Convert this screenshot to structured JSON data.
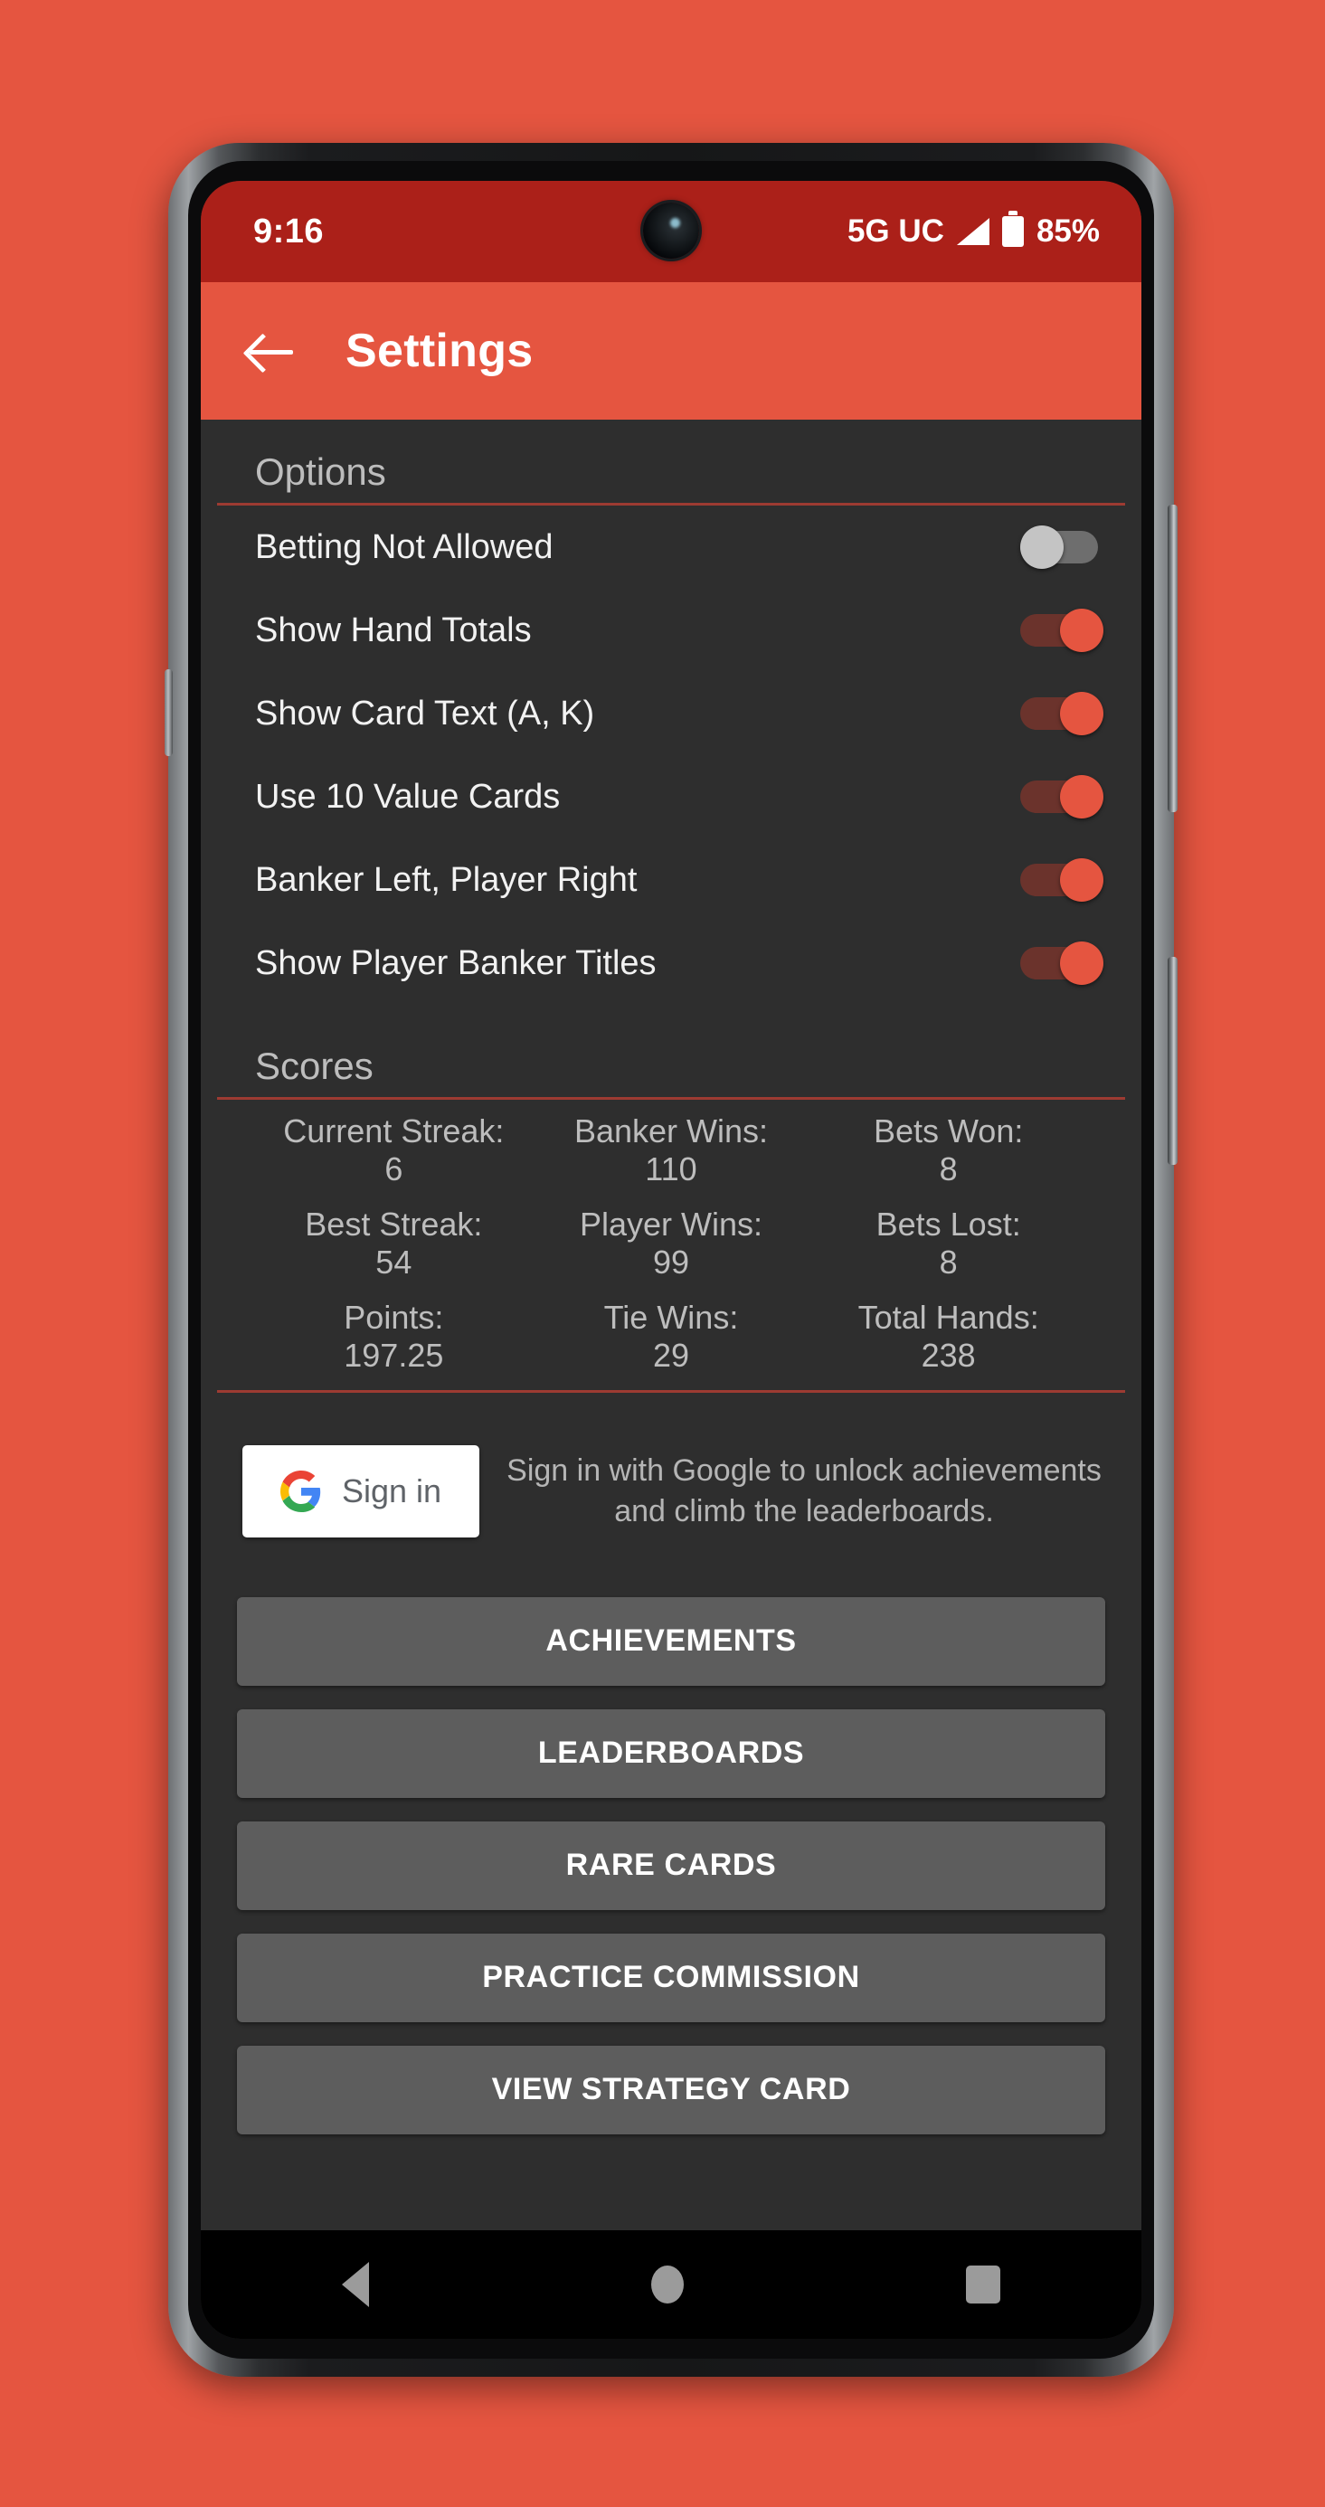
{
  "status_bar": {
    "time": "9:16",
    "network": "5G UC",
    "battery_percent": "85%",
    "signal_icon": "signal-triangle-icon",
    "battery_icon": "battery-icon"
  },
  "app_bar": {
    "back_icon": "back-arrow-icon",
    "title": "Settings"
  },
  "options": {
    "header": "Options",
    "items": [
      {
        "label": "Betting Not Allowed",
        "state": "off"
      },
      {
        "label": "Show Hand Totals",
        "state": "on"
      },
      {
        "label": "Show Card Text (A, K)",
        "state": "on"
      },
      {
        "label": "Use 10 Value Cards",
        "state": "on"
      },
      {
        "label": "Banker Left, Player Right",
        "state": "on"
      },
      {
        "label": "Show Player Banker Titles",
        "state": "on"
      }
    ]
  },
  "scores": {
    "header": "Scores",
    "cells": [
      {
        "label": "Current Streak:",
        "value": "6"
      },
      {
        "label": "Banker Wins:",
        "value": "110"
      },
      {
        "label": "Bets Won:",
        "value": "8"
      },
      {
        "label": "Best Streak:",
        "value": "54"
      },
      {
        "label": "Player Wins:",
        "value": "99"
      },
      {
        "label": "Bets Lost:",
        "value": "8"
      },
      {
        "label": "Points:",
        "value": "197.25"
      },
      {
        "label": "Tie Wins:",
        "value": "29"
      },
      {
        "label": "Total Hands:",
        "value": "238"
      }
    ]
  },
  "signin": {
    "button_label": "Sign in",
    "icon": "google-g-icon",
    "description": "Sign in with Google to unlock achievements and climb the leaderboards."
  },
  "action_buttons": [
    {
      "label": "ACHIEVEMENTS"
    },
    {
      "label": "LEADERBOARDS"
    },
    {
      "label": "RARE CARDS"
    },
    {
      "label": "PRACTICE COMMISSION"
    },
    {
      "label": "VIEW STRATEGY CARD"
    }
  ],
  "nav_bar": {
    "back": "nav-back-icon",
    "home": "nav-home-icon",
    "recents": "nav-recents-icon"
  },
  "colors": {
    "accent": "#e55540",
    "status_bar": "#ab2019",
    "content_bg": "#2e2e2e",
    "divider": "#9d3b32",
    "button_bg": "#5d5d5d"
  }
}
